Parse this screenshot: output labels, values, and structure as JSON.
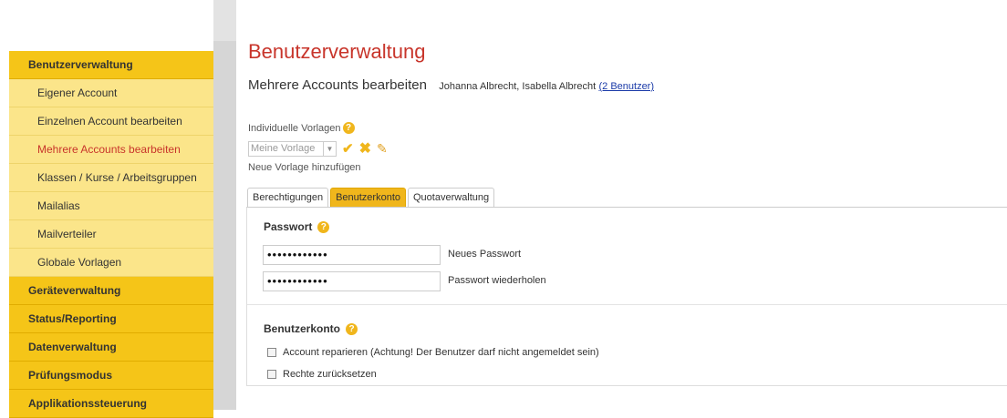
{
  "sidebar": {
    "sections": [
      {
        "label": "Benutzerverwaltung"
      },
      {
        "label": "Geräteverwaltung"
      },
      {
        "label": "Status/Reporting"
      },
      {
        "label": "Datenverwaltung"
      },
      {
        "label": "Prüfungsmodus"
      },
      {
        "label": "Applikationssteuerung"
      }
    ],
    "items": [
      {
        "label": "Eigener Account"
      },
      {
        "label": "Einzelnen Account bearbeiten"
      },
      {
        "label": "Mehrere Accounts bearbeiten",
        "active": true
      },
      {
        "label": "Klassen / Kurse / Arbeitsgruppen"
      },
      {
        "label": "Mailalias"
      },
      {
        "label": "Mailverteiler"
      },
      {
        "label": "Globale Vorlagen"
      }
    ]
  },
  "main": {
    "title": "Benutzerverwaltung",
    "subtitle": "Mehrere Accounts bearbeiten",
    "users": "Johanna Albrecht, Isabella Albrecht",
    "users_link": "(2 Benutzer)",
    "templates": {
      "label": "Individuelle Vorlagen",
      "help": "?",
      "select_value": "Meine Vorlage",
      "new_label": "Neue Vorlage hinzufügen"
    },
    "tabs": [
      {
        "label": "Berechtigungen"
      },
      {
        "label": "Benutzerkonto",
        "active": true
      },
      {
        "label": "Quotaverwaltung"
      }
    ],
    "password": {
      "title": "Passwort",
      "help": "?",
      "field1_value": "••••••••••••",
      "field1_label": "Neues Passwort",
      "field2_value": "••••••••••••",
      "field2_label": "Passwort wiederholen"
    },
    "account": {
      "title": "Benutzerkonto",
      "help": "?",
      "option1": "Account reparieren (Achtung! Der Benutzer darf nicht angemeldet sein)",
      "option2": "Rechte zurücksetzen"
    }
  },
  "colors": {
    "accent_red": "#c8352b",
    "section_yellow": "#f5c518",
    "item_yellow": "#fbe58a",
    "link_blue": "#1a3aa8"
  }
}
